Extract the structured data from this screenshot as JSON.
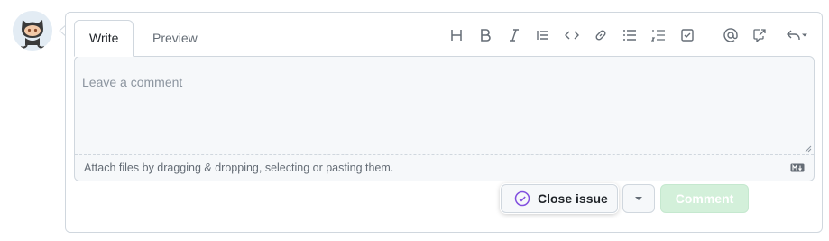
{
  "tabs": {
    "write": "Write",
    "preview": "Preview"
  },
  "toolbar": {
    "icons": [
      "heading-icon",
      "bold-icon",
      "italic-icon",
      "quote-icon",
      "code-icon",
      "link-icon",
      "unordered-list-icon",
      "ordered-list-icon",
      "task-list-icon",
      "mention-icon",
      "reference-icon",
      "undo-icon"
    ]
  },
  "comment": {
    "placeholder": "Leave a comment",
    "value": ""
  },
  "attach": {
    "text": "Attach files by dragging & dropping, selecting or pasting them."
  },
  "actions": {
    "close_issue": "Close issue",
    "comment": "Comment"
  },
  "colors": {
    "accent_purple": "#8250df",
    "comment_disabled_bg": "#d3f0da",
    "border": "#d0d7de"
  }
}
